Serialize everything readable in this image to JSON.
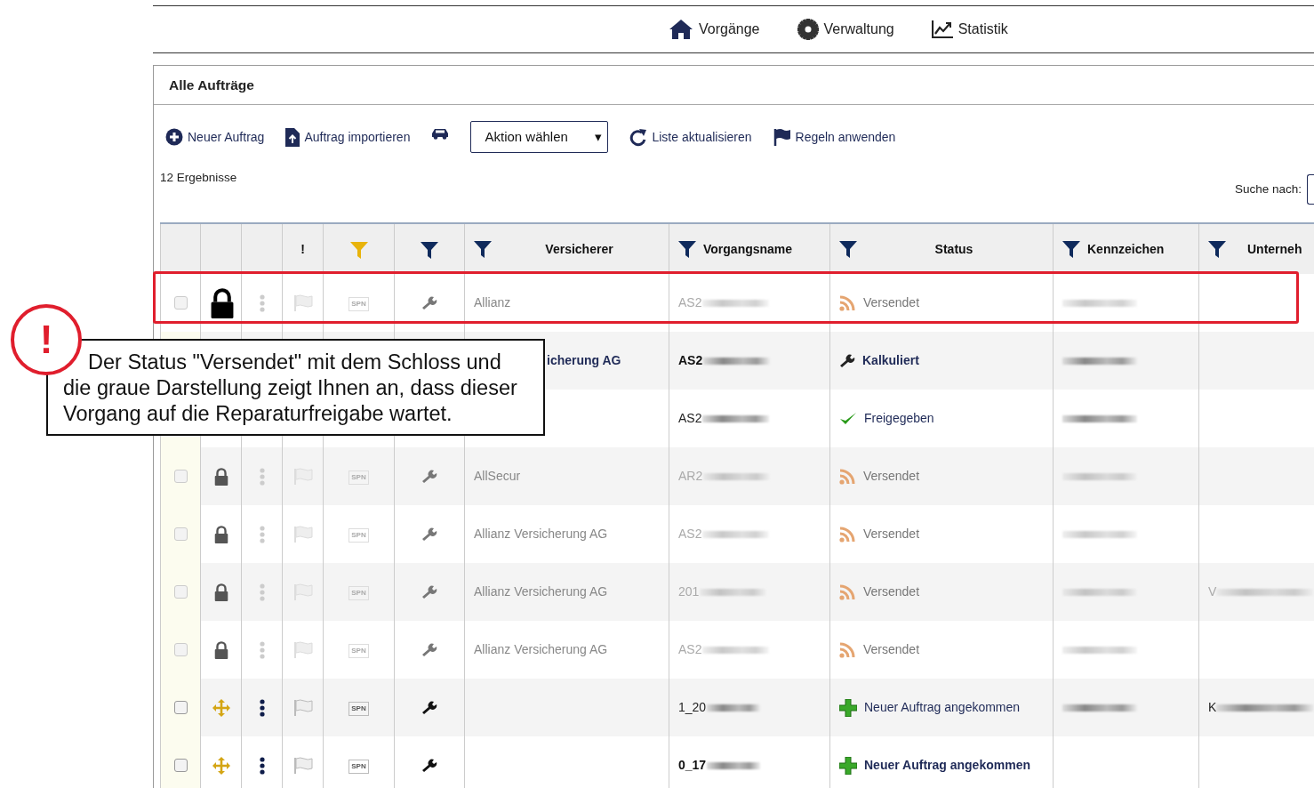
{
  "nav": [
    {
      "label": "Vorgänge"
    },
    {
      "label": "Verwaltung"
    },
    {
      "label": "Statistik"
    }
  ],
  "panel_title": "Alle Aufträge",
  "toolbar": [
    {
      "kind": "link",
      "label": "Neuer Auftrag"
    },
    {
      "kind": "link",
      "label": "Auftrag importieren"
    },
    {
      "kind": "icon"
    },
    {
      "kind": "select",
      "label": "Aktion wählen",
      "caret": "▾"
    },
    {
      "kind": "link",
      "label": "Liste aktualisieren"
    },
    {
      "kind": "link",
      "label": "Regeln anwenden"
    }
  ],
  "result_count": "12 Ergebnisse",
  "search": {
    "label": "Suche nach:"
  },
  "columns": [
    {
      "kind": "blank"
    },
    {
      "kind": "blank"
    },
    {
      "kind": "blank"
    },
    {
      "kind": "text",
      "label": "!"
    },
    {
      "kind": "filter",
      "filter_active": true
    },
    {
      "kind": "filter",
      "filter_active": false
    },
    {
      "kind": "filter",
      "filter_active": false,
      "label": "Versicherer"
    },
    {
      "kind": "filter",
      "filter_active": false,
      "label": "Vorgangsname"
    },
    {
      "kind": "filter",
      "filter_active": false,
      "label": "Status"
    },
    {
      "kind": "filter",
      "filter_active": false,
      "label": "Kennzeichen"
    },
    {
      "kind": "filter",
      "filter_active": false,
      "label": "Unterneh"
    }
  ],
  "rows": [
    {
      "kind": "locked",
      "highlighted": true,
      "checked": false,
      "dimmed": true,
      "bold": false,
      "tag": "SPN",
      "versicherer": "Allianz",
      "vorgang": "AS2",
      "status": {
        "kind": "sent",
        "label": "Versendet"
      },
      "kennzeichen_redacted": true
    },
    {
      "kind": "covered",
      "highlighted": false,
      "dimmed": false,
      "bold": true,
      "versicherer": "icherung AG",
      "vorgang": "AS2",
      "status": {
        "kind": "calculated",
        "label": "Kalkuliert"
      },
      "kennzeichen_redacted": true
    },
    {
      "kind": "covered",
      "highlighted": false,
      "dimmed": false,
      "bold": false,
      "vorgang": "AS2",
      "status": {
        "kind": "approved",
        "label": "Freigegeben"
      },
      "kennzeichen_redacted": true
    },
    {
      "kind": "locked",
      "highlighted": false,
      "checked": false,
      "dimmed": true,
      "bold": false,
      "tag": "SPN",
      "versicherer": "AllSecur",
      "vorgang": "AR2",
      "status": {
        "kind": "sent",
        "label": "Versendet"
      },
      "kennzeichen_redacted": true
    },
    {
      "kind": "locked",
      "highlighted": false,
      "checked": false,
      "dimmed": true,
      "bold": false,
      "tag": "SPN",
      "versicherer": "Allianz Versicherung AG",
      "vorgang": "AS2",
      "status": {
        "kind": "sent",
        "label": "Versendet"
      },
      "kennzeichen_redacted": true
    },
    {
      "kind": "locked",
      "highlighted": false,
      "checked": false,
      "dimmed": true,
      "bold": false,
      "tag": "SPN",
      "versicherer": "Allianz Versicherung AG",
      "vorgang": "201",
      "status": {
        "kind": "sent",
        "label": "Versendet"
      },
      "kennzeichen_redacted": true,
      "unternehmen": "V",
      "unternehmen_redacted": true
    },
    {
      "kind": "locked",
      "highlighted": false,
      "checked": false,
      "dimmed": true,
      "bold": false,
      "tag": "SPN",
      "versicherer": "Allianz Versicherung AG",
      "vorgang": "AS2",
      "status": {
        "kind": "sent",
        "label": "Versendet"
      },
      "kennzeichen_redacted": true
    },
    {
      "kind": "new",
      "highlighted": false,
      "checked": false,
      "dimmed": false,
      "bold": false,
      "tag": "SPN",
      "vorgang": "1_20",
      "status": {
        "kind": "new",
        "label": "Neuer Auftrag angekommen"
      },
      "kennzeichen_redacted": true,
      "unternehmen": "K",
      "unternehmen_redacted": true
    },
    {
      "kind": "new",
      "highlighted": false,
      "checked": false,
      "dimmed": false,
      "bold": true,
      "tag": "SPN",
      "vorgang": "0_17",
      "status": {
        "kind": "new",
        "label": "Neuer Auftrag angekommen"
      },
      "kennzeichen_redacted": false
    }
  ],
  "callout": {
    "mark": "!",
    "text": "Der Status \"Versendet\" mit dem Schloss und die graue Darstellung zeigt Ihnen an, dass dieser Vorgang auf die Reparaturfreigabe wartet."
  }
}
